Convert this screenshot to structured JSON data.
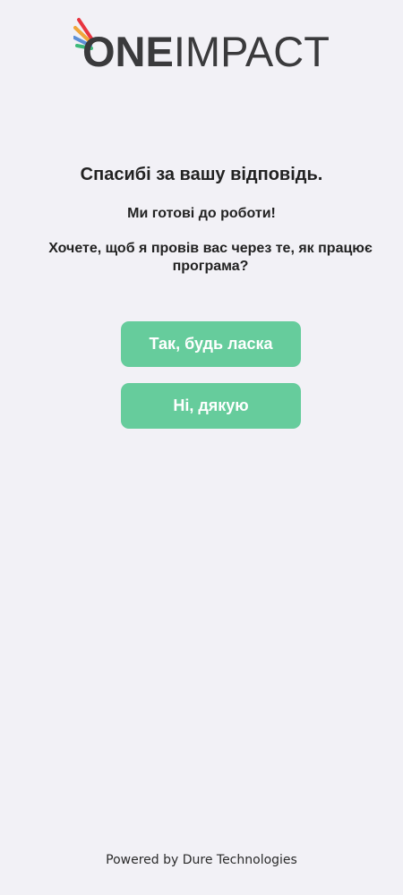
{
  "logo": {
    "part_one": "ONE",
    "part_two": "IMPACT",
    "ray_colors": [
      "#e8343f",
      "#f0a63a",
      "#5c8fd6",
      "#3dba7a"
    ]
  },
  "content": {
    "title": "Спасибі за вашу відповідь.",
    "subtitle": "Ми готові до роботи!",
    "question": "Хочете, щоб я провів вас через те, як працює програма?"
  },
  "buttons": {
    "yes_label": "Так, будь ласка",
    "no_label": "Ні, дякую",
    "color": "#66cc9c"
  },
  "footer": {
    "text": "Powered by Dure Technologies"
  }
}
